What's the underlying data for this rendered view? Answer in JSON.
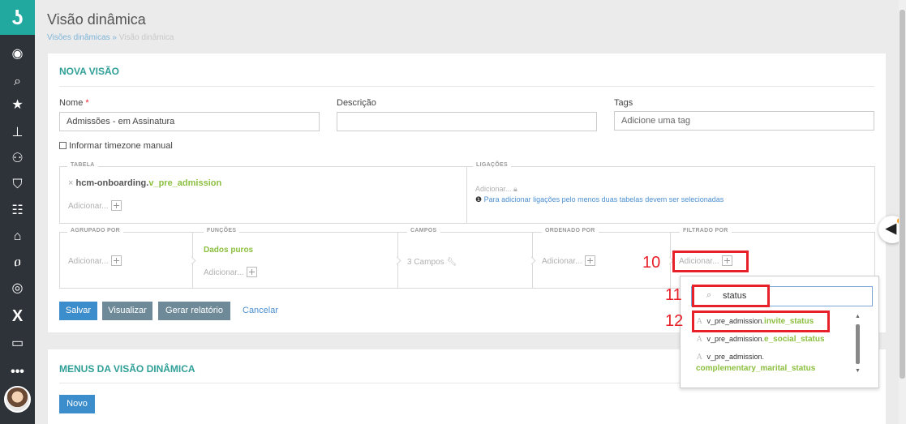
{
  "page": {
    "title": "Visão dinâmica",
    "breadcrumb_link": "Visões dinâmicas",
    "breadcrumb_sep": "»",
    "breadcrumb_current": "Visão dinâmica"
  },
  "form": {
    "section_title": "NOVA VISÃO",
    "name_label": "Nome",
    "required_mark": "*",
    "name_value": "Admissões - em Assinatura",
    "description_label": "Descrição",
    "description_value": "",
    "tags_label": "Tags",
    "tags_placeholder": "Adicione uma tag",
    "timezone_label": "Informar timezone manual"
  },
  "builder": {
    "tabela_legend": "TABELA",
    "table_remove": "×",
    "table_schema": "hcm-onboarding.",
    "table_name": "v_pre_admission",
    "add_label": "Adicionar...",
    "ligacoes_legend": "LIGAÇÕES",
    "ligacoes_add": "Adicionar...",
    "ligacoes_info_icon": "❶",
    "ligacoes_info": "Para adicionar ligações pelo menos duas tabelas devem ser selecionadas",
    "agrupado_legend": "AGRUPADO POR",
    "funcoes_legend": "FUNÇÕES",
    "funcoes_value": "Dados puros",
    "campos_legend": "CAMPOS",
    "campos_value": "3 Campos",
    "ordenado_legend": "ORDENADO POR",
    "filtrado_legend": "FILTRADO POR"
  },
  "actions": {
    "save": "Salvar",
    "preview": "Visualizar",
    "report": "Gerar relatório",
    "cancel": "Cancelar"
  },
  "menus": {
    "section_title": "MENUS DA VISÃO DINÂMICA",
    "new_button": "Novo"
  },
  "annotations": {
    "m10": "10",
    "m11": "11",
    "m12": "12"
  },
  "dropdown": {
    "search_value": "status",
    "items": [
      {
        "table": "v_pre_admission.",
        "field": "invite_status"
      },
      {
        "table": "v_pre_admission.",
        "field": "e_social_status"
      },
      {
        "table": "v_pre_admission.",
        "field": "complementary_marital_status"
      }
    ]
  },
  "colors": {
    "accent": "#2f9f98",
    "primary_button": "#3c8dcb",
    "secondary_button": "#6e8a98",
    "highlight": "#e8202a",
    "field_green": "#8bbf3f"
  },
  "icons": {
    "sidebar": [
      "user-circle-icon",
      "search-icon",
      "star-icon",
      "org-chart-icon",
      "users-icon",
      "shield-icon",
      "group-icon",
      "building-icon",
      "hands-icon",
      "target-icon",
      "x-icon",
      "monitor-icon",
      "more-icon"
    ]
  }
}
